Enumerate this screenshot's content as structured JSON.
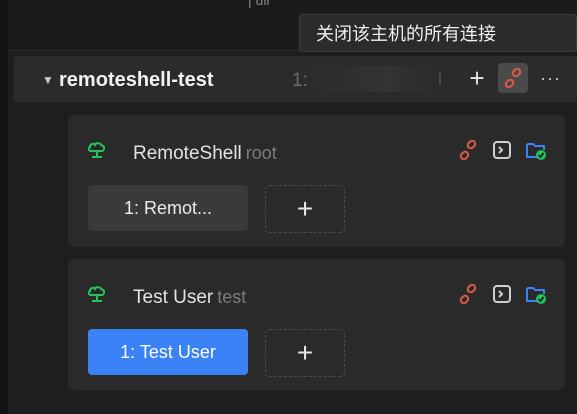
{
  "top_bar": {
    "cut_text": "| uli"
  },
  "tooltip": {
    "text": "关闭该主机的所有连接"
  },
  "host": {
    "name": "remoteshell-test",
    "ip_visible": "1:",
    "caret": "▼",
    "add_glyph": "+",
    "more_glyph": "···"
  },
  "connections": [
    {
      "name": "RemoteShell",
      "user": "root",
      "session_label": "1: Remot...",
      "session_active": false,
      "add_glyph": "+"
    },
    {
      "name": "Test User",
      "user": "test",
      "session_label": "1: Test User",
      "session_active": true,
      "add_glyph": "+"
    }
  ],
  "colors": {
    "accent_blue": "#3b82f6",
    "link_red": "#e05a4a",
    "cloud_green": "#22c55e",
    "folder_blue": "#3b82f6"
  },
  "icons": [
    "cloud-icon",
    "disconnect-link-icon",
    "terminal-icon",
    "folder-check-icon"
  ]
}
